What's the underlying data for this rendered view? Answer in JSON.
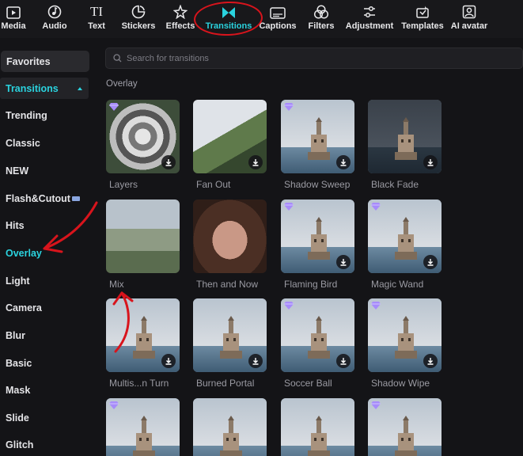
{
  "toolbar": {
    "items": [
      {
        "label": "Media",
        "icon": "media-icon"
      },
      {
        "label": "Audio",
        "icon": "audio-icon"
      },
      {
        "label": "Text",
        "icon": "text-icon"
      },
      {
        "label": "Stickers",
        "icon": "stickers-icon"
      },
      {
        "label": "Effects",
        "icon": "effects-icon"
      },
      {
        "label": "Transitions",
        "icon": "transitions-icon"
      },
      {
        "label": "Captions",
        "icon": "captions-icon"
      },
      {
        "label": "Filters",
        "icon": "filters-icon"
      },
      {
        "label": "Adjustment",
        "icon": "adjustment-icon"
      },
      {
        "label": "Templates",
        "icon": "templates-icon"
      },
      {
        "label": "AI avatar",
        "icon": "ai-avatar-icon"
      }
    ],
    "text_glyph": "TI",
    "active": "Transitions",
    "accent_color": "#2ad3df"
  },
  "sidebar": {
    "favorites": "Favorites",
    "group": "Transitions",
    "items": [
      {
        "label": "Trending"
      },
      {
        "label": "Classic"
      },
      {
        "label": "NEW"
      },
      {
        "label": "Flash&Cutout"
      },
      {
        "label": "Hits"
      },
      {
        "label": "Overlay"
      },
      {
        "label": "Light"
      },
      {
        "label": "Camera"
      },
      {
        "label": "Blur"
      },
      {
        "label": "Basic"
      },
      {
        "label": "Mask"
      },
      {
        "label": "Slide"
      },
      {
        "label": "Glitch"
      }
    ],
    "active": "Overlay"
  },
  "search": {
    "placeholder": "Search for transitions"
  },
  "section": {
    "title": "Overlay"
  },
  "transitions": [
    {
      "label": "Layers",
      "premium": true,
      "download": true
    },
    {
      "label": "Fan Out",
      "premium": false,
      "download": true
    },
    {
      "label": "Shadow Sweep",
      "premium": true,
      "download": true
    },
    {
      "label": "Black Fade",
      "premium": false,
      "download": true
    },
    {
      "label": "Mix",
      "premium": false,
      "download": false
    },
    {
      "label": "Then and Now",
      "premium": false,
      "download": false
    },
    {
      "label": "Flaming Bird",
      "premium": true,
      "download": true
    },
    {
      "label": "Magic Wand",
      "premium": true,
      "download": true
    },
    {
      "label": "Multis...n Turn",
      "premium": false,
      "download": true
    },
    {
      "label": "Burned Portal",
      "premium": false,
      "download": true
    },
    {
      "label": "Soccer Ball",
      "premium": true,
      "download": true
    },
    {
      "label": "Shadow Wipe",
      "premium": true,
      "download": true
    },
    {
      "label": "",
      "premium": true,
      "download": false
    },
    {
      "label": "",
      "premium": false,
      "download": false
    },
    {
      "label": "",
      "premium": false,
      "download": false
    },
    {
      "label": "",
      "premium": true,
      "download": false
    }
  ],
  "annotation_color": "#d8141c"
}
